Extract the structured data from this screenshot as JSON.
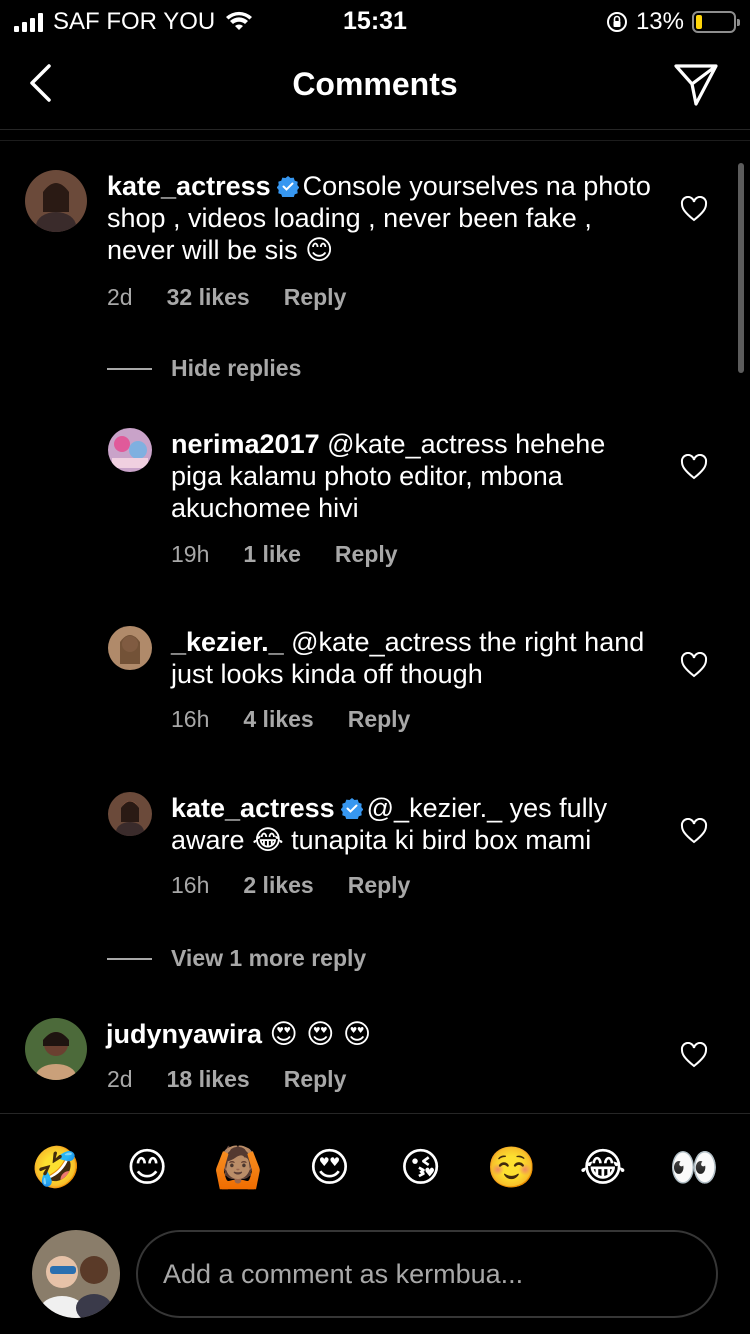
{
  "status_bar": {
    "carrier": "SAF FOR YOU",
    "time": "15:31",
    "battery": "13%"
  },
  "header": {
    "title": "Comments"
  },
  "comments": [
    {
      "username": "kate_actress",
      "verified": true,
      "text": "Console yourselves na photo shop , videos loading , never been fake , never will be sis",
      "emoji": "😊",
      "time": "2d",
      "likes": "32 likes",
      "reply": "Reply"
    },
    {
      "username": "judynyawira",
      "verified": false,
      "text": "",
      "emoji": "😍 😍 😍",
      "time": "2d",
      "likes": "18 likes",
      "reply": "Reply"
    }
  ],
  "thread": {
    "hide_replies": "Hide replies",
    "view_more": "View 1 more reply"
  },
  "replies": [
    {
      "username": "nerima2017",
      "mention": "@kate_actress",
      "text": "hehehe piga kalamu photo editor, mbona akuchomee hivi",
      "time": "19h",
      "likes": "1 like",
      "reply": "Reply"
    },
    {
      "username": "_kezier._",
      "mention": "@kate_actress",
      "text": "the right hand just looks kinda off though",
      "time": "16h",
      "likes": "4 likes",
      "reply": "Reply"
    },
    {
      "username": "kate_actress",
      "verified": true,
      "mention": "@_kezier._",
      "text_line1": "yes fully",
      "text_line2a": "aware",
      "emoji": "😂",
      "text_line2b": "tunapita ki bird box mami",
      "time": "16h",
      "likes": "2 likes",
      "reply": "Reply"
    }
  ],
  "emoji_bar": [
    "🤣",
    "😊",
    "🙆🏽",
    "😍",
    "😘",
    "☺️",
    "😂",
    "👀"
  ],
  "input": {
    "placeholder": "Add a comment as kermbua..."
  },
  "colors": {
    "background": "#000000",
    "text": "#ffffff",
    "secondary": "#a8a8a8",
    "verified": "#3797f0",
    "battery": "#ffd60a"
  }
}
